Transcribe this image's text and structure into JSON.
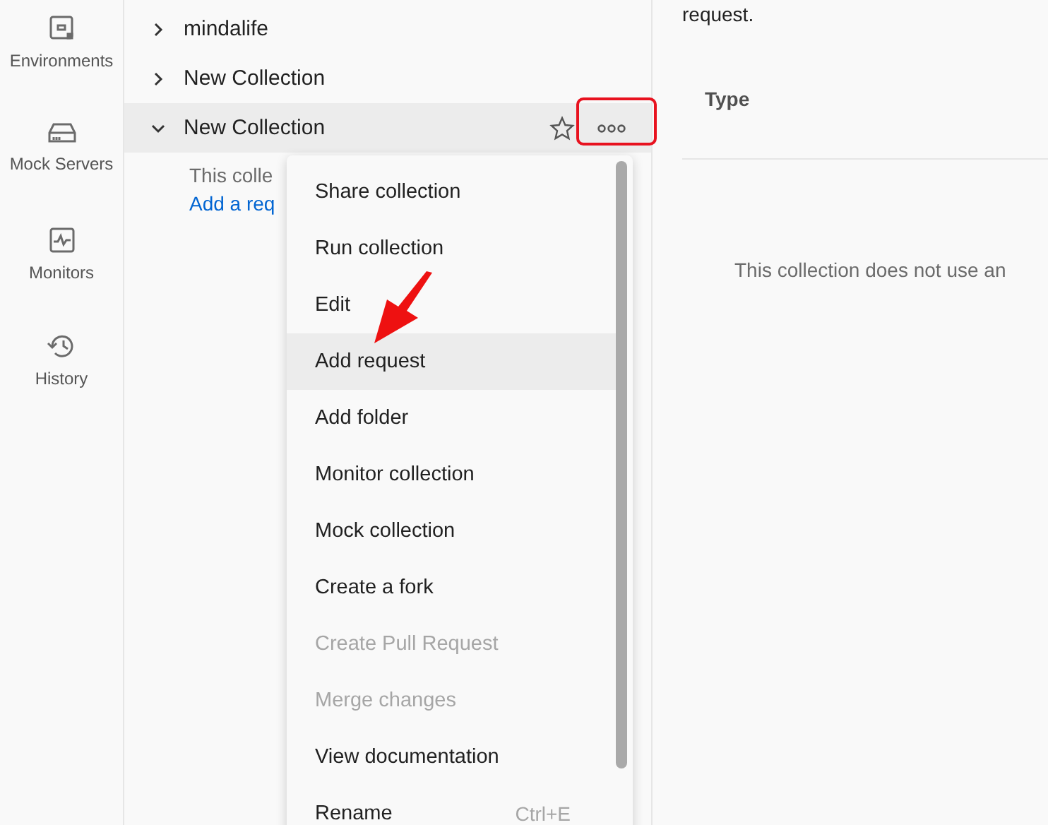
{
  "rail": [
    {
      "label": "Environments"
    },
    {
      "label": "Mock Servers"
    },
    {
      "label": "Monitors"
    },
    {
      "label": "History"
    }
  ],
  "collections": [
    {
      "name": "mindalife",
      "expanded": false,
      "selected": false
    },
    {
      "name": "New Collection",
      "expanded": false,
      "selected": false
    },
    {
      "name": "New Collection",
      "expanded": true,
      "selected": true,
      "empty_text": "This colle",
      "add_link": "Add a req"
    }
  ],
  "menu": [
    {
      "label": "Share collection",
      "disabled": false,
      "selected": false
    },
    {
      "label": "Run collection",
      "disabled": false,
      "selected": false
    },
    {
      "label": "Edit",
      "disabled": false,
      "selected": false
    },
    {
      "label": "Add request",
      "disabled": false,
      "selected": true
    },
    {
      "label": "Add folder",
      "disabled": false,
      "selected": false
    },
    {
      "label": "Monitor collection",
      "disabled": false,
      "selected": false
    },
    {
      "label": "Mock collection",
      "disabled": false,
      "selected": false
    },
    {
      "label": "Create a fork",
      "disabled": false,
      "selected": false
    },
    {
      "label": "Create Pull Request",
      "disabled": true,
      "selected": false
    },
    {
      "label": "Merge changes",
      "disabled": true,
      "selected": false
    },
    {
      "label": "View documentation",
      "disabled": false,
      "selected": false
    },
    {
      "label": "Rename",
      "disabled": false,
      "selected": false,
      "shortcut": "Ctrl+E"
    }
  ],
  "content": {
    "intro": "request.",
    "column_header": "Type",
    "empty_message": "This collection does not use an"
  }
}
